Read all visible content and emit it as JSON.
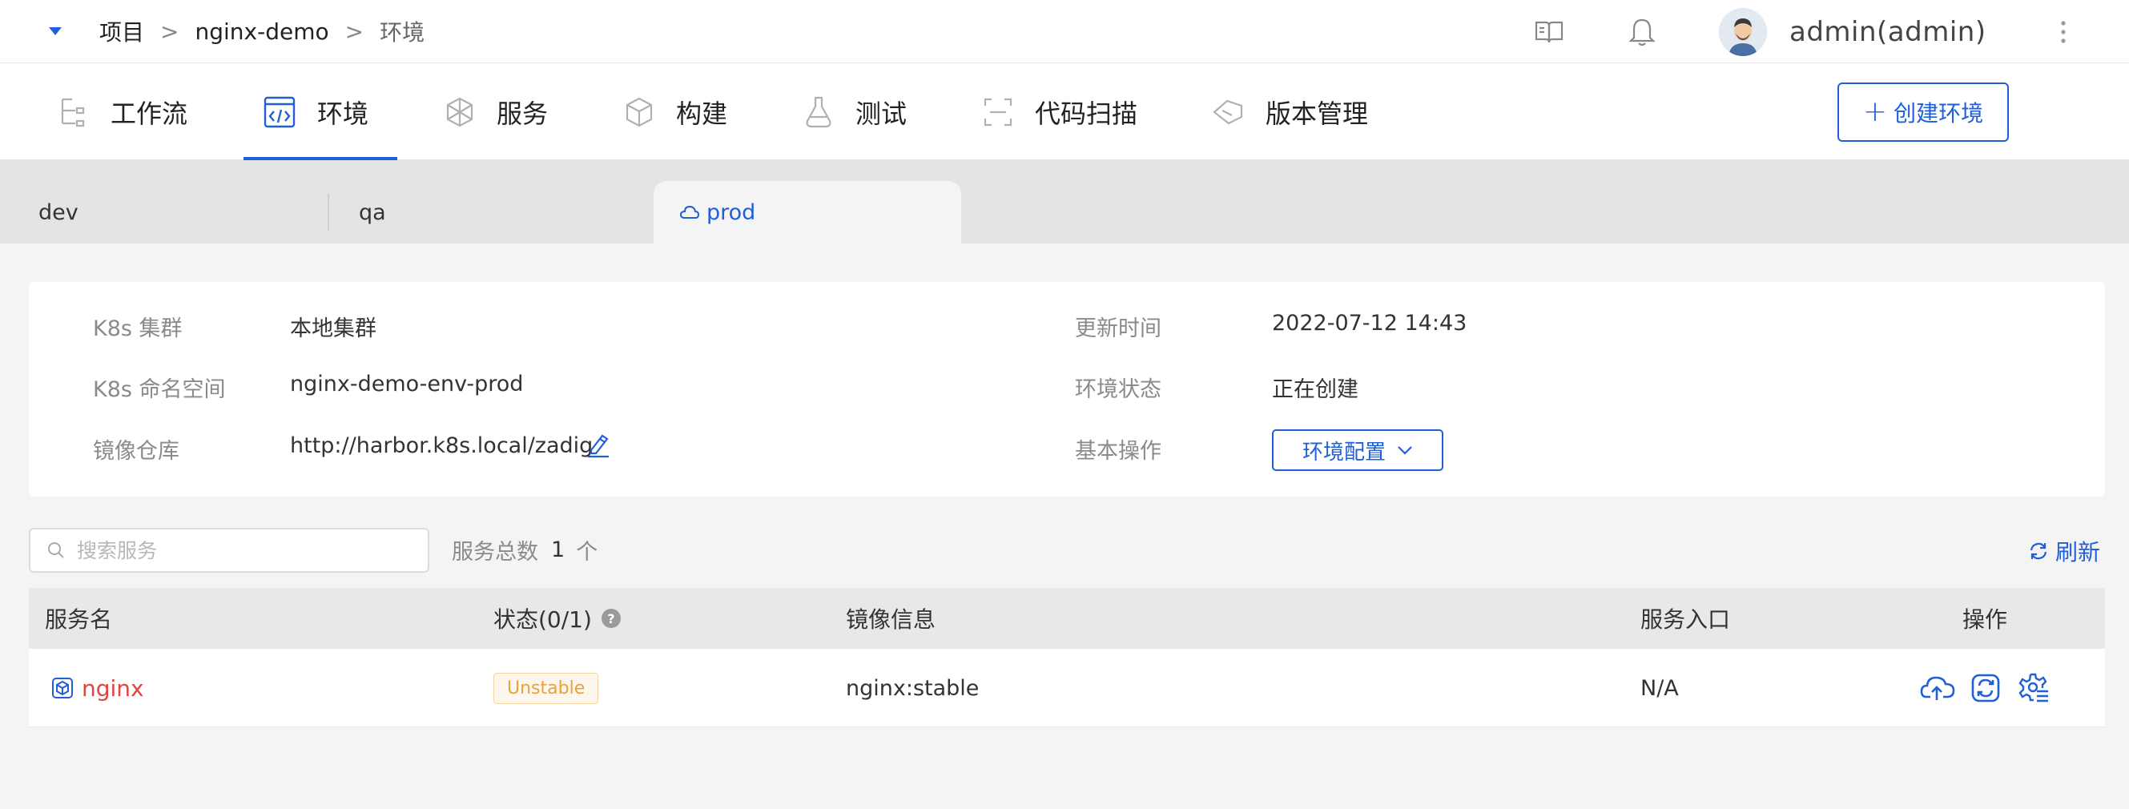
{
  "breadcrumb": [
    "项目",
    "nginx-demo",
    "环境"
  ],
  "header": {
    "username": "admin(admin)"
  },
  "nav": {
    "tabs": [
      {
        "label": "工作流",
        "icon": "workflow-icon"
      },
      {
        "label": "环境",
        "icon": "environment-icon",
        "active": true
      },
      {
        "label": "服务",
        "icon": "service-icon"
      },
      {
        "label": "构建",
        "icon": "build-icon"
      },
      {
        "label": "测试",
        "icon": "test-flask-icon"
      },
      {
        "label": "代码扫描",
        "icon": "scan-icon"
      },
      {
        "label": "版本管理",
        "icon": "version-icon"
      }
    ],
    "create_button": "创建环境"
  },
  "env_tabs": [
    {
      "label": "dev"
    },
    {
      "label": "qa"
    },
    {
      "label": "prod",
      "active": true
    }
  ],
  "info": {
    "cluster_label": "K8s 集群",
    "cluster_value": "本地集群",
    "namespace_label": "K8s 命名空间",
    "namespace_value": "nginx-demo-env-prod",
    "registry_label": "镜像仓库",
    "registry_value": "http://harbor.k8s.local/zadig",
    "updated_label": "更新时间",
    "updated_value": "2022-07-12 14:43",
    "status_label": "环境状态",
    "status_value": "正在创建",
    "ops_label": "基本操作",
    "config_button": "环境配置"
  },
  "services": {
    "search_placeholder": "搜索服务",
    "count_label": "服务总数",
    "count_value": "1",
    "count_unit": "个",
    "refresh_label": "刷新",
    "columns": [
      "服务名",
      "状态(0/1)",
      "镜像信息",
      "服务入口",
      "操作"
    ],
    "rows": [
      {
        "name": "nginx",
        "status": "Unstable",
        "image": "nginx:stable",
        "entry": "N/A"
      }
    ]
  },
  "colors": {
    "accent": "#1f5fd8",
    "service_name": "#e0453f",
    "unstable": "#e6a23c"
  }
}
